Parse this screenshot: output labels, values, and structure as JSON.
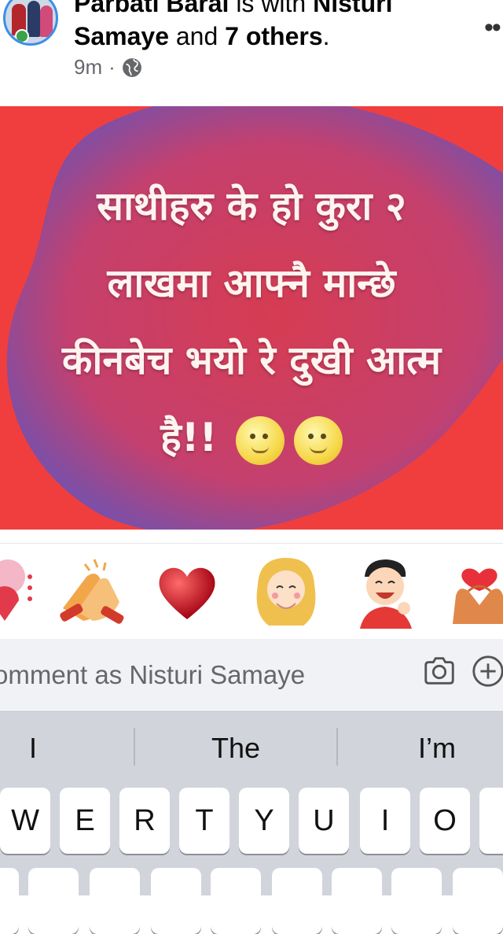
{
  "post": {
    "author": "Parbati Baral",
    "is_with_text": " is with ",
    "tagged_first": "Nisturi",
    "tagged_first_cont": "Samaye",
    "and_text": " and ",
    "others": "7 others",
    "period": ".",
    "time": "9m",
    "separator": "·",
    "privacy_icon": "globe-icon",
    "more_icon": "more-dots-icon",
    "more_label": "••",
    "image_text": {
      "line1": "साथीहरु के हो कुरा २",
      "line2": "लाखमा आफ्नै मान्छे",
      "line3": "कीनबेच भयो रे दुखी आत्म",
      "line4": "है!!"
    }
  },
  "stickers": [
    "hug-sticker",
    "clapping-hands-sticker",
    "red-heart-sticker",
    "blushing-girl-sticker",
    "laughing-boy-sticker",
    "heart-hands-sticker"
  ],
  "comment": {
    "placeholder": "omment as Nisturi Samaye",
    "camera_icon": "camera-icon",
    "add_icon": "plus-circle-icon"
  },
  "keyboard": {
    "suggestions": [
      "I",
      "The",
      "I’m"
    ],
    "row1": [
      "W",
      "E",
      "R",
      "T",
      "Y",
      "U",
      "I",
      "O"
    ]
  },
  "colors": {
    "post_bg": "#f03e3e",
    "blob": "#8a4a9e",
    "keyboard_bg": "#d1d4db",
    "comment_bg": "#f0f2f5",
    "avatar_ring": "#3b8fe8"
  }
}
